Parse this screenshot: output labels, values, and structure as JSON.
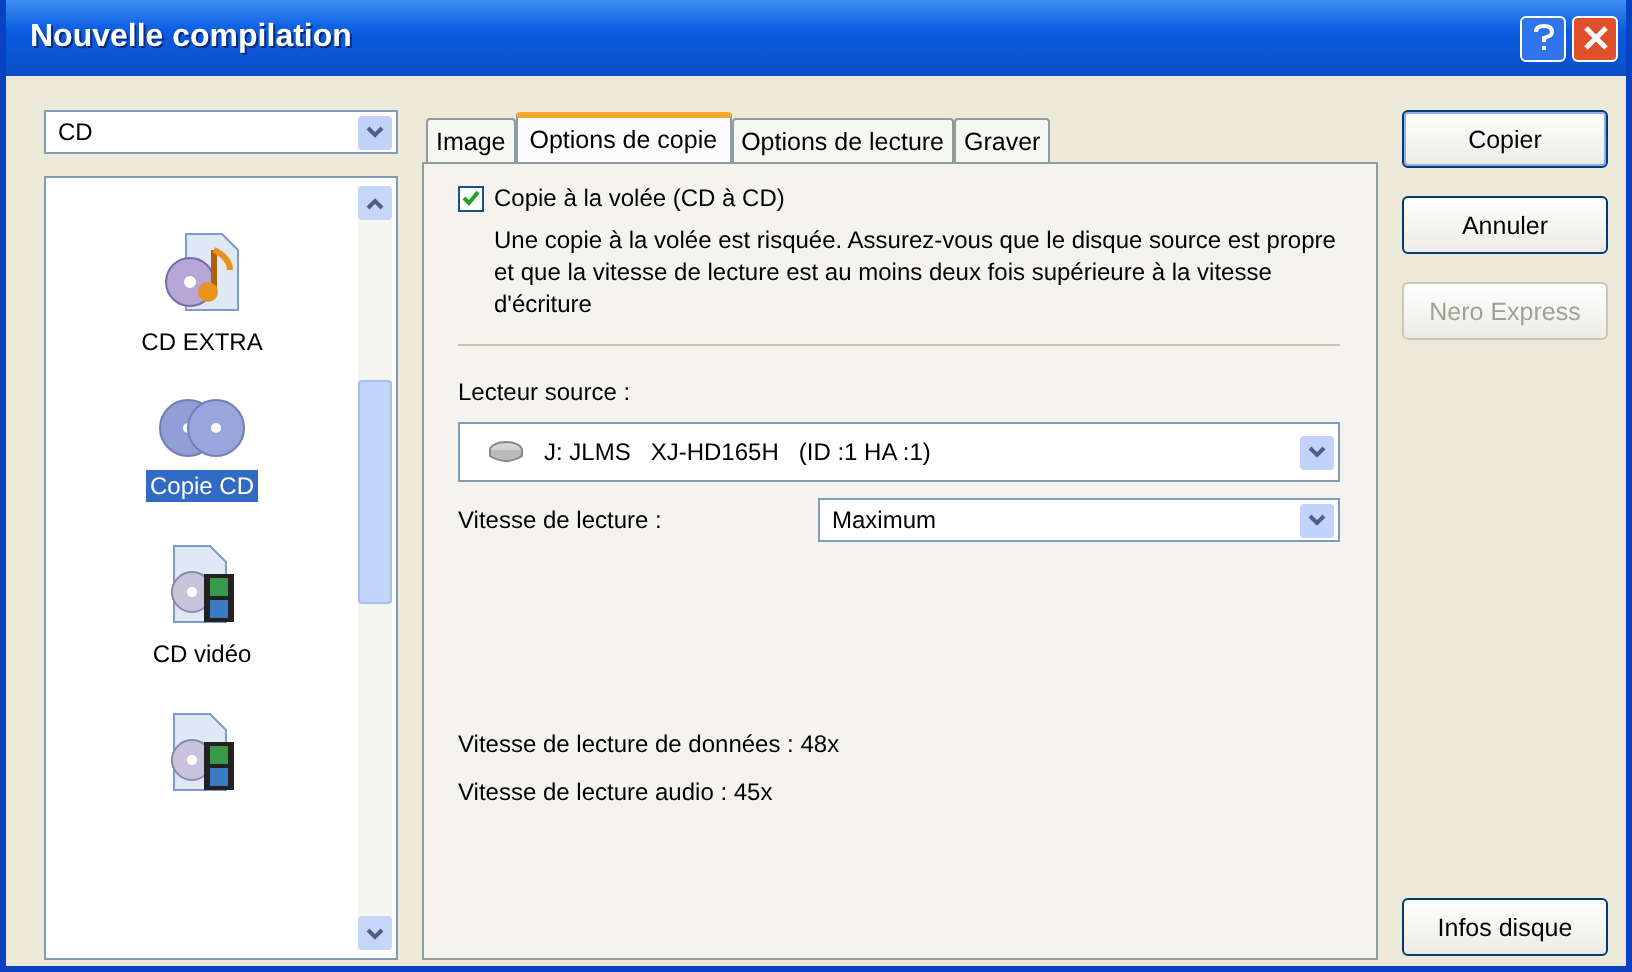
{
  "window": {
    "title": "Nouvelle compilation"
  },
  "type_select": {
    "value": "CD"
  },
  "sidebar": {
    "items": [
      {
        "label": "CD EXTRA",
        "kind": "extra",
        "selected": false
      },
      {
        "label": "Copie CD",
        "kind": "copy",
        "selected": true
      },
      {
        "label": "CD vidéo",
        "kind": "video",
        "selected": false
      },
      {
        "kind": "video",
        "selected": false
      }
    ]
  },
  "tabs": [
    {
      "label": "Image",
      "selected": false
    },
    {
      "label": "Options de copie",
      "selected": true
    },
    {
      "label": "Options de lecture",
      "selected": false
    },
    {
      "label": "Graver",
      "selected": false
    }
  ],
  "panel": {
    "checkbox": {
      "label": "Copie à la volée (CD à CD)",
      "checked": true
    },
    "warning": "Une copie à la volée est risquée. Assurez-vous que le disque source est propre et que la vitesse de lecture est au moins deux fois supérieure à la vitesse d'écriture",
    "source_label": "Lecteur source :",
    "source_select": {
      "drive": "J: JLMS",
      "model": "XJ-HD165H",
      "ids": "(ID :1  HA :1)"
    },
    "speed_label": "Vitesse de lecture :",
    "speed_select": {
      "value": "Maximum"
    },
    "info": [
      "Vitesse de lecture de données : 48x",
      "Vitesse de lecture audio : 45x"
    ]
  },
  "buttons": [
    {
      "label": "Copier",
      "disabled": false
    },
    {
      "label": "Annuler",
      "disabled": false
    },
    {
      "label": "Nero Express",
      "disabled": true
    }
  ],
  "bottom_button": {
    "label": "Infos disque",
    "disabled": false
  }
}
